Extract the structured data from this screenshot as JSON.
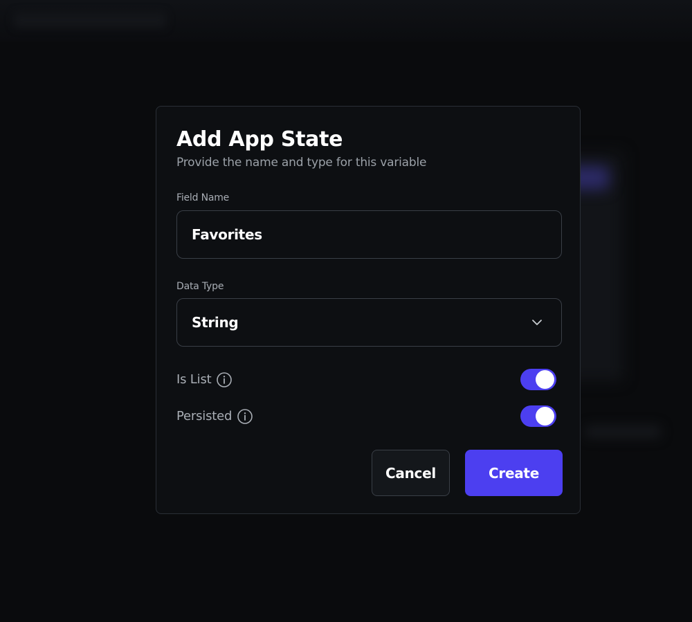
{
  "dialog": {
    "title": "Add App State",
    "subtitle": "Provide the name and type for this variable"
  },
  "field_name": {
    "label": "Field Name",
    "value": "Favorites"
  },
  "data_type": {
    "label": "Data Type",
    "value": "String",
    "icon": "chevron-down-icon"
  },
  "toggles": {
    "is_list": {
      "label": "Is List",
      "on": true,
      "icon": "info-icon"
    },
    "persisted": {
      "label": "Persisted",
      "on": true,
      "icon": "info-icon"
    }
  },
  "buttons": {
    "cancel": "Cancel",
    "create": "Create"
  },
  "colors": {
    "accent": "#4C3FF0",
    "background": "#0D0F12",
    "border": "#3A3F47"
  }
}
